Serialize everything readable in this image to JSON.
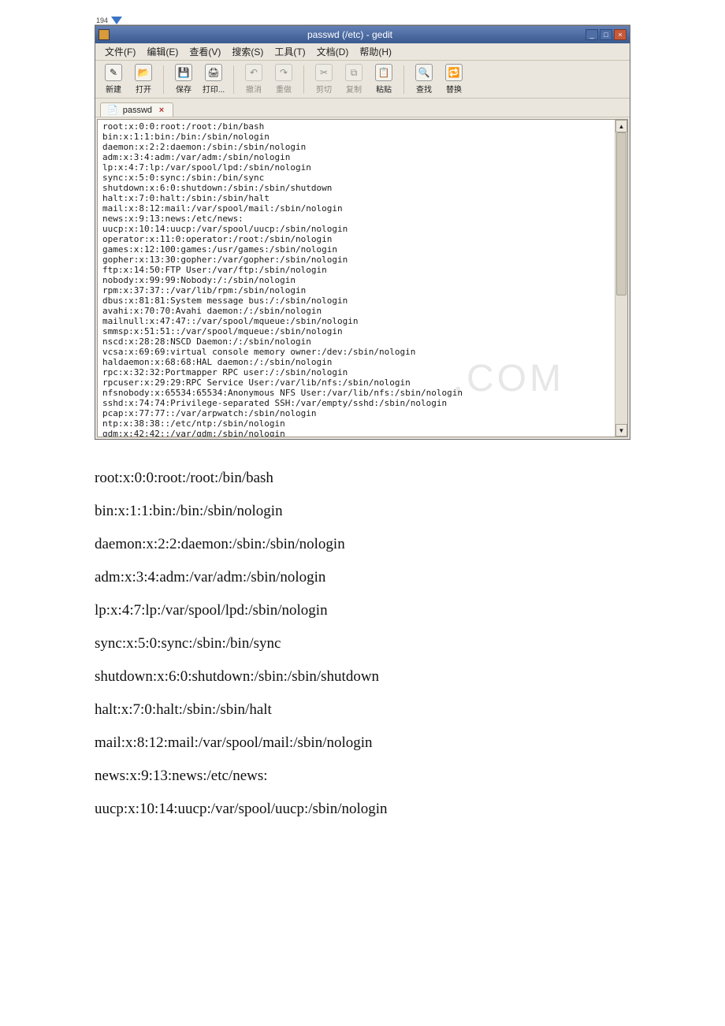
{
  "fragment_top": "194",
  "titlebar": {
    "title": "passwd (/etc) - gedit"
  },
  "menu": [
    {
      "label": "文件(F)",
      "u": "F"
    },
    {
      "label": "编辑(E)",
      "u": "E"
    },
    {
      "label": "查看(V)",
      "u": "V"
    },
    {
      "label": "搜索(S)",
      "u": "S"
    },
    {
      "label": "工具(T)",
      "u": "T"
    },
    {
      "label": "文档(D)",
      "u": "D"
    },
    {
      "label": "帮助(H)",
      "u": "H"
    }
  ],
  "toolbar": [
    {
      "name": "new",
      "label": "新建",
      "glyph": "✎",
      "enabled": true
    },
    {
      "name": "open",
      "label": "打开",
      "glyph": "📂",
      "enabled": true
    },
    {
      "sep": true
    },
    {
      "name": "save",
      "label": "保存",
      "glyph": "💾",
      "enabled": true
    },
    {
      "name": "print",
      "label": "打印...",
      "glyph": "🖨",
      "enabled": true
    },
    {
      "sep": true
    },
    {
      "name": "undo",
      "label": "撤消",
      "glyph": "↶",
      "enabled": false
    },
    {
      "name": "redo",
      "label": "重做",
      "glyph": "↷",
      "enabled": false
    },
    {
      "sep": true
    },
    {
      "name": "cut",
      "label": "剪切",
      "glyph": "✂",
      "enabled": false
    },
    {
      "name": "copy",
      "label": "复制",
      "glyph": "⧉",
      "enabled": false
    },
    {
      "name": "paste",
      "label": "粘贴",
      "glyph": "📋",
      "enabled": true
    },
    {
      "sep": true
    },
    {
      "name": "find",
      "label": "查找",
      "glyph": "🔍",
      "enabled": true
    },
    {
      "name": "replace",
      "label": "替换",
      "glyph": "🔁",
      "enabled": true
    }
  ],
  "tab": {
    "label": "passwd"
  },
  "file_lines": [
    "root:x:0:0:root:/root:/bin/bash",
    "bin:x:1:1:bin:/bin:/sbin/nologin",
    "daemon:x:2:2:daemon:/sbin:/sbin/nologin",
    "adm:x:3:4:adm:/var/adm:/sbin/nologin",
    "lp:x:4:7:lp:/var/spool/lpd:/sbin/nologin",
    "sync:x:5:0:sync:/sbin:/bin/sync",
    "shutdown:x:6:0:shutdown:/sbin:/sbin/shutdown",
    "halt:x:7:0:halt:/sbin:/sbin/halt",
    "mail:x:8:12:mail:/var/spool/mail:/sbin/nologin",
    "news:x:9:13:news:/etc/news:",
    "uucp:x:10:14:uucp:/var/spool/uucp:/sbin/nologin",
    "operator:x:11:0:operator:/root:/sbin/nologin",
    "games:x:12:100:games:/usr/games:/sbin/nologin",
    "gopher:x:13:30:gopher:/var/gopher:/sbin/nologin",
    "ftp:x:14:50:FTP User:/var/ftp:/sbin/nologin",
    "nobody:x:99:99:Nobody:/:/sbin/nologin",
    "rpm:x:37:37::/var/lib/rpm:/sbin/nologin",
    "dbus:x:81:81:System message bus:/:/sbin/nologin",
    "avahi:x:70:70:Avahi daemon:/:/sbin/nologin",
    "mailnull:x:47:47::/var/spool/mqueue:/sbin/nologin",
    "smmsp:x:51:51::/var/spool/mqueue:/sbin/nologin",
    "nscd:x:28:28:NSCD Daemon:/:/sbin/nologin",
    "vcsa:x:69:69:virtual console memory owner:/dev:/sbin/nologin",
    "haldaemon:x:68:68:HAL daemon:/:/sbin/nologin",
    "rpc:x:32:32:Portmapper RPC user:/:/sbin/nologin",
    "rpcuser:x:29:29:RPC Service User:/var/lib/nfs:/sbin/nologin",
    "nfsnobody:x:65534:65534:Anonymous NFS User:/var/lib/nfs:/sbin/nologin",
    "sshd:x:74:74:Privilege-separated SSH:/var/empty/sshd:/sbin/nologin",
    "pcap:x:77:77::/var/arpwatch:/sbin/nologin",
    "ntp:x:38:38::/etc/ntp:/sbin/nologin",
    "gdm:x:42:42::/var/gdm:/sbin/nologin"
  ],
  "watermark": ".COM",
  "body_lines": [
    "root:x:0:0:root:/root:/bin/bash",
    "bin:x:1:1:bin:/bin:/sbin/nologin",
    "daemon:x:2:2:daemon:/sbin:/sbin/nologin",
    "adm:x:3:4:adm:/var/adm:/sbin/nologin",
    "lp:x:4:7:lp:/var/spool/lpd:/sbin/nologin",
    "sync:x:5:0:sync:/sbin:/bin/sync",
    "shutdown:x:6:0:shutdown:/sbin:/sbin/shutdown",
    "halt:x:7:0:halt:/sbin:/sbin/halt",
    "mail:x:8:12:mail:/var/spool/mail:/sbin/nologin",
    "news:x:9:13:news:/etc/news:",
    "uucp:x:10:14:uucp:/var/spool/uucp:/sbin/nologin"
  ]
}
